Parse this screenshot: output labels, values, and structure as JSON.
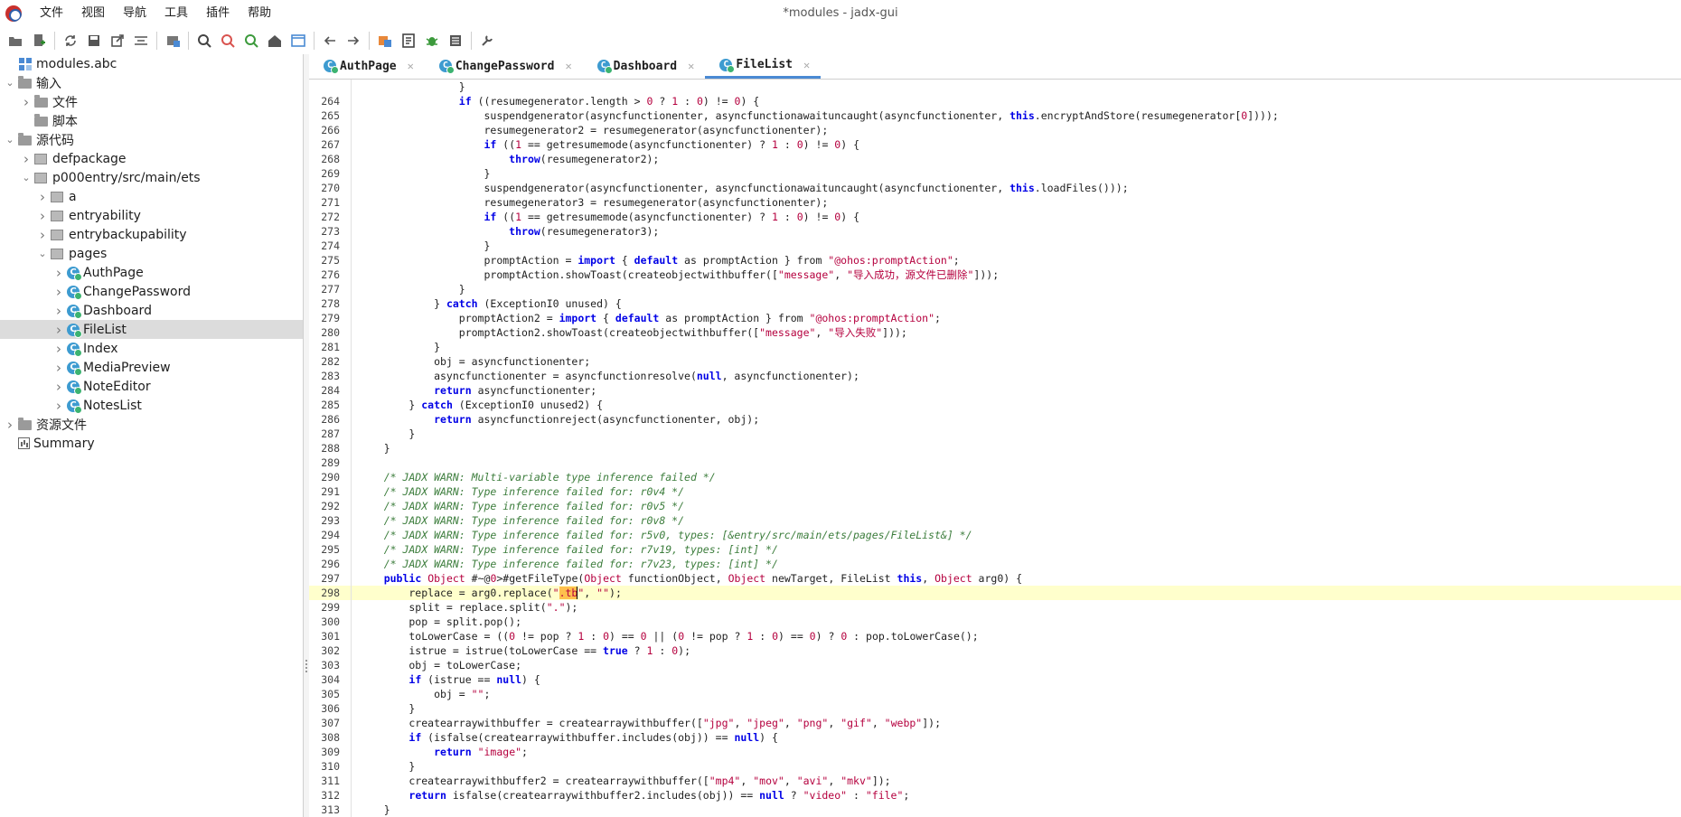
{
  "window": {
    "title": "*modules - jadx-gui"
  },
  "menu": [
    "文件",
    "视图",
    "导航",
    "工具",
    "插件",
    "帮助"
  ],
  "toolbar": {
    "buttons": [
      "open-icon",
      "add-file-icon",
      "sync-icon",
      "save-icon",
      "export-icon",
      "flatten-icon",
      "package-icon",
      "search-icon",
      "find-usage-icon",
      "find-code-icon",
      "home-icon",
      "window-icon",
      "back-icon",
      "forward-icon",
      "deobfuscate-icon",
      "log-icon",
      "debug-icon",
      "console-icon",
      "settings-icon"
    ]
  },
  "tree": [
    {
      "label": "modules.abc",
      "icon": "grid-icon",
      "arrow": "",
      "depth": 0
    },
    {
      "label": "输入",
      "icon": "folder-icon",
      "arrow": "down",
      "depth": 0
    },
    {
      "label": "文件",
      "icon": "folder-icon",
      "arrow": "right",
      "depth": 1
    },
    {
      "label": "脚本",
      "icon": "folder-icon",
      "arrow": "",
      "depth": 1
    },
    {
      "label": "源代码",
      "icon": "folder-icon",
      "arrow": "down",
      "depth": 0
    },
    {
      "label": "defpackage",
      "icon": "package-icon",
      "arrow": "right",
      "depth": 1
    },
    {
      "label": "p000entry/src/main/ets",
      "icon": "package-icon",
      "arrow": "down",
      "depth": 1
    },
    {
      "label": "a",
      "icon": "package-icon",
      "arrow": "right",
      "depth": 2
    },
    {
      "label": "entryability",
      "icon": "package-icon",
      "arrow": "right",
      "depth": 2
    },
    {
      "label": "entrybackupability",
      "icon": "package-icon",
      "arrow": "right",
      "depth": 2
    },
    {
      "label": "pages",
      "icon": "package-icon",
      "arrow": "down",
      "depth": 2
    },
    {
      "label": "AuthPage",
      "icon": "class-icon",
      "arrow": "right",
      "depth": 3
    },
    {
      "label": "ChangePassword",
      "icon": "class-icon",
      "arrow": "right",
      "depth": 3
    },
    {
      "label": "Dashboard",
      "icon": "class-icon",
      "arrow": "right",
      "depth": 3
    },
    {
      "label": "FileList",
      "icon": "class-icon",
      "arrow": "right",
      "depth": 3,
      "selected": true
    },
    {
      "label": "Index",
      "icon": "class-icon",
      "arrow": "right",
      "depth": 3
    },
    {
      "label": "MediaPreview",
      "icon": "class-icon",
      "arrow": "right",
      "depth": 3
    },
    {
      "label": "NoteEditor",
      "icon": "class-icon",
      "arrow": "right",
      "depth": 3
    },
    {
      "label": "NotesList",
      "icon": "class-icon",
      "arrow": "right",
      "depth": 3
    },
    {
      "label": "资源文件",
      "icon": "folder-icon",
      "arrow": "right",
      "depth": 0
    },
    {
      "label": "Summary",
      "icon": "summary-icon",
      "arrow": "",
      "depth": 0
    }
  ],
  "tabs": [
    {
      "label": "AuthPage",
      "active": false
    },
    {
      "label": "ChangePassword",
      "active": false
    },
    {
      "label": "Dashboard",
      "active": false
    },
    {
      "label": "FileList",
      "active": true
    }
  ],
  "code": [
    {
      "n": "",
      "t": "                }"
    },
    {
      "n": "264",
      "t": "                if ((resumegenerator.length > 0 ? 1 : 0) != 0) {"
    },
    {
      "n": "265",
      "t": "                    suspendgenerator(asyncfunctionenter, asyncfunctionawaituncaught(asyncfunctionenter, this.encryptAndStore(resumegenerator[0])));"
    },
    {
      "n": "266",
      "t": "                    resumegenerator2 = resumegenerator(asyncfunctionenter);"
    },
    {
      "n": "267",
      "t": "                    if ((1 == getresumemode(asyncfunctionenter) ? 1 : 0) != 0) {"
    },
    {
      "n": "268",
      "t": "                        throw(resumegenerator2);"
    },
    {
      "n": "269",
      "t": "                    }"
    },
    {
      "n": "270",
      "t": "                    suspendgenerator(asyncfunctionenter, asyncfunctionawaituncaught(asyncfunctionenter, this.loadFiles()));"
    },
    {
      "n": "271",
      "t": "                    resumegenerator3 = resumegenerator(asyncfunctionenter);"
    },
    {
      "n": "272",
      "t": "                    if ((1 == getresumemode(asyncfunctionenter) ? 1 : 0) != 0) {"
    },
    {
      "n": "273",
      "t": "                        throw(resumegenerator3);"
    },
    {
      "n": "274",
      "t": "                    }"
    },
    {
      "n": "275",
      "t": "                    promptAction = import { default as promptAction } from \"@ohos:promptAction\";"
    },
    {
      "n": "276",
      "t": "                    promptAction.showToast(createobjectwithbuffer([\"message\", \"导入成功，源文件已删除\"]));"
    },
    {
      "n": "277",
      "t": "                }"
    },
    {
      "n": "278",
      "t": "            } catch (ExceptionI0 unused) {"
    },
    {
      "n": "279",
      "t": "                promptAction2 = import { default as promptAction } from \"@ohos:promptAction\";"
    },
    {
      "n": "280",
      "t": "                promptAction2.showToast(createobjectwithbuffer([\"message\", \"导入失败\"]));"
    },
    {
      "n": "281",
      "t": "            }"
    },
    {
      "n": "282",
      "t": "            obj = asyncfunctionenter;"
    },
    {
      "n": "283",
      "t": "            asyncfunctionenter = asyncfunctionresolve(null, asyncfunctionenter);"
    },
    {
      "n": "284",
      "t": "            return asyncfunctionenter;"
    },
    {
      "n": "285",
      "t": "        } catch (ExceptionI0 unused2) {"
    },
    {
      "n": "286",
      "t": "            return asyncfunctionreject(asyncfunctionenter, obj);"
    },
    {
      "n": "287",
      "t": "        }"
    },
    {
      "n": "288",
      "t": "    }"
    },
    {
      "n": "289",
      "t": ""
    },
    {
      "n": "290",
      "t": "    /* JADX WARN: Multi-variable type inference failed */"
    },
    {
      "n": "291",
      "t": "    /* JADX WARN: Type inference failed for: r0v4 */"
    },
    {
      "n": "292",
      "t": "    /* JADX WARN: Type inference failed for: r0v5 */"
    },
    {
      "n": "293",
      "t": "    /* JADX WARN: Type inference failed for: r0v8 */"
    },
    {
      "n": "294",
      "t": "    /* JADX WARN: Type inference failed for: r5v0, types: [&entry/src/main/ets/pages/FileList&] */"
    },
    {
      "n": "295",
      "t": "    /* JADX WARN: Type inference failed for: r7v19, types: [int] */"
    },
    {
      "n": "296",
      "t": "    /* JADX WARN: Type inference failed for: r7v23, types: [int] */"
    },
    {
      "n": "297",
      "t": "    public Object #~@0>#getFileType(Object functionObject, Object newTarget, FileList this, Object arg0) {"
    },
    {
      "n": "298",
      "t": "        replace = arg0.replace(\".tb\", \"\");",
      "current": true
    },
    {
      "n": "299",
      "t": "        split = replace.split(\".\");"
    },
    {
      "n": "300",
      "t": "        pop = split.pop();"
    },
    {
      "n": "301",
      "t": "        toLowerCase = ((0 != pop ? 1 : 0) == 0 || (0 != pop ? 1 : 0) == 0) ? 0 : pop.toLowerCase();"
    },
    {
      "n": "302",
      "t": "        istrue = istrue(toLowerCase == true ? 1 : 0);"
    },
    {
      "n": "303",
      "t": "        obj = toLowerCase;"
    },
    {
      "n": "304",
      "t": "        if (istrue == null) {"
    },
    {
      "n": "305",
      "t": "            obj = \"\";"
    },
    {
      "n": "306",
      "t": "        }"
    },
    {
      "n": "307",
      "t": "        createarraywithbuffer = createarraywithbuffer([\"jpg\", \"jpeg\", \"png\", \"gif\", \"webp\"]);"
    },
    {
      "n": "308",
      "t": "        if (isfalse(createarraywithbuffer.includes(obj)) == null) {"
    },
    {
      "n": "309",
      "t": "            return \"image\";"
    },
    {
      "n": "310",
      "t": "        }"
    },
    {
      "n": "311",
      "t": "        createarraywithbuffer2 = createarraywithbuffer([\"mp4\", \"mov\", \"avi\", \"mkv\"]);"
    },
    {
      "n": "312",
      "t": "        return isfalse(createarraywithbuffer2.includes(obj)) == null ? \"video\" : \"file\";"
    },
    {
      "n": "313",
      "t": "    }"
    },
    {
      "n": "314",
      "t": ""
    }
  ]
}
